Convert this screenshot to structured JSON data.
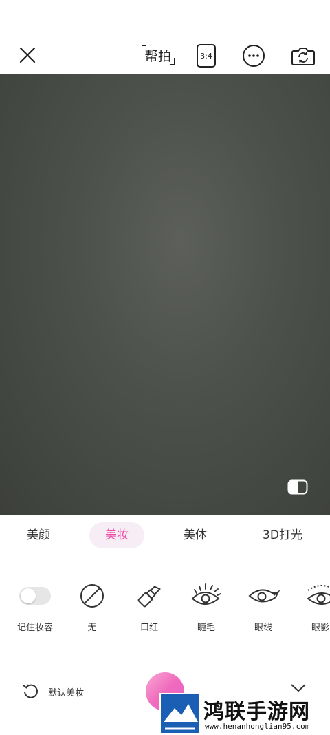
{
  "topbar": {
    "help_shot_label": "帮拍",
    "ratio_label": "3:4",
    "icons": [
      "close-icon",
      "more-icon",
      "switch-camera-icon"
    ]
  },
  "viewfinder": {
    "icons": [
      "compare-icon"
    ]
  },
  "tabs": [
    {
      "label": "美颜",
      "active": false
    },
    {
      "label": "美妆",
      "active": true
    },
    {
      "label": "美体",
      "active": false
    },
    {
      "label": "3D打光",
      "active": false
    }
  ],
  "makeup": {
    "items": [
      {
        "label": "记住妆容",
        "icon": "toggle-switch"
      },
      {
        "label": "无",
        "icon": "none-icon"
      },
      {
        "label": "口红",
        "icon": "lipstick-icon"
      },
      {
        "label": "睫毛",
        "icon": "eyelash-icon"
      },
      {
        "label": "眼线",
        "icon": "eyeliner-icon"
      },
      {
        "label": "眼影",
        "icon": "eyeshadow-icon"
      }
    ],
    "remember_toggle_on": false
  },
  "bottom": {
    "default_makeup_label": "默认美妆",
    "icons": [
      "reset-icon",
      "collapse-icon"
    ]
  },
  "watermark": {
    "title": "鸿联手游网",
    "url": "www.henanhonglian95.com"
  },
  "colors": {
    "accent": "#ee4aa8",
    "accent_bg": "#f6eef4",
    "viewfinder": "#4d514c"
  }
}
